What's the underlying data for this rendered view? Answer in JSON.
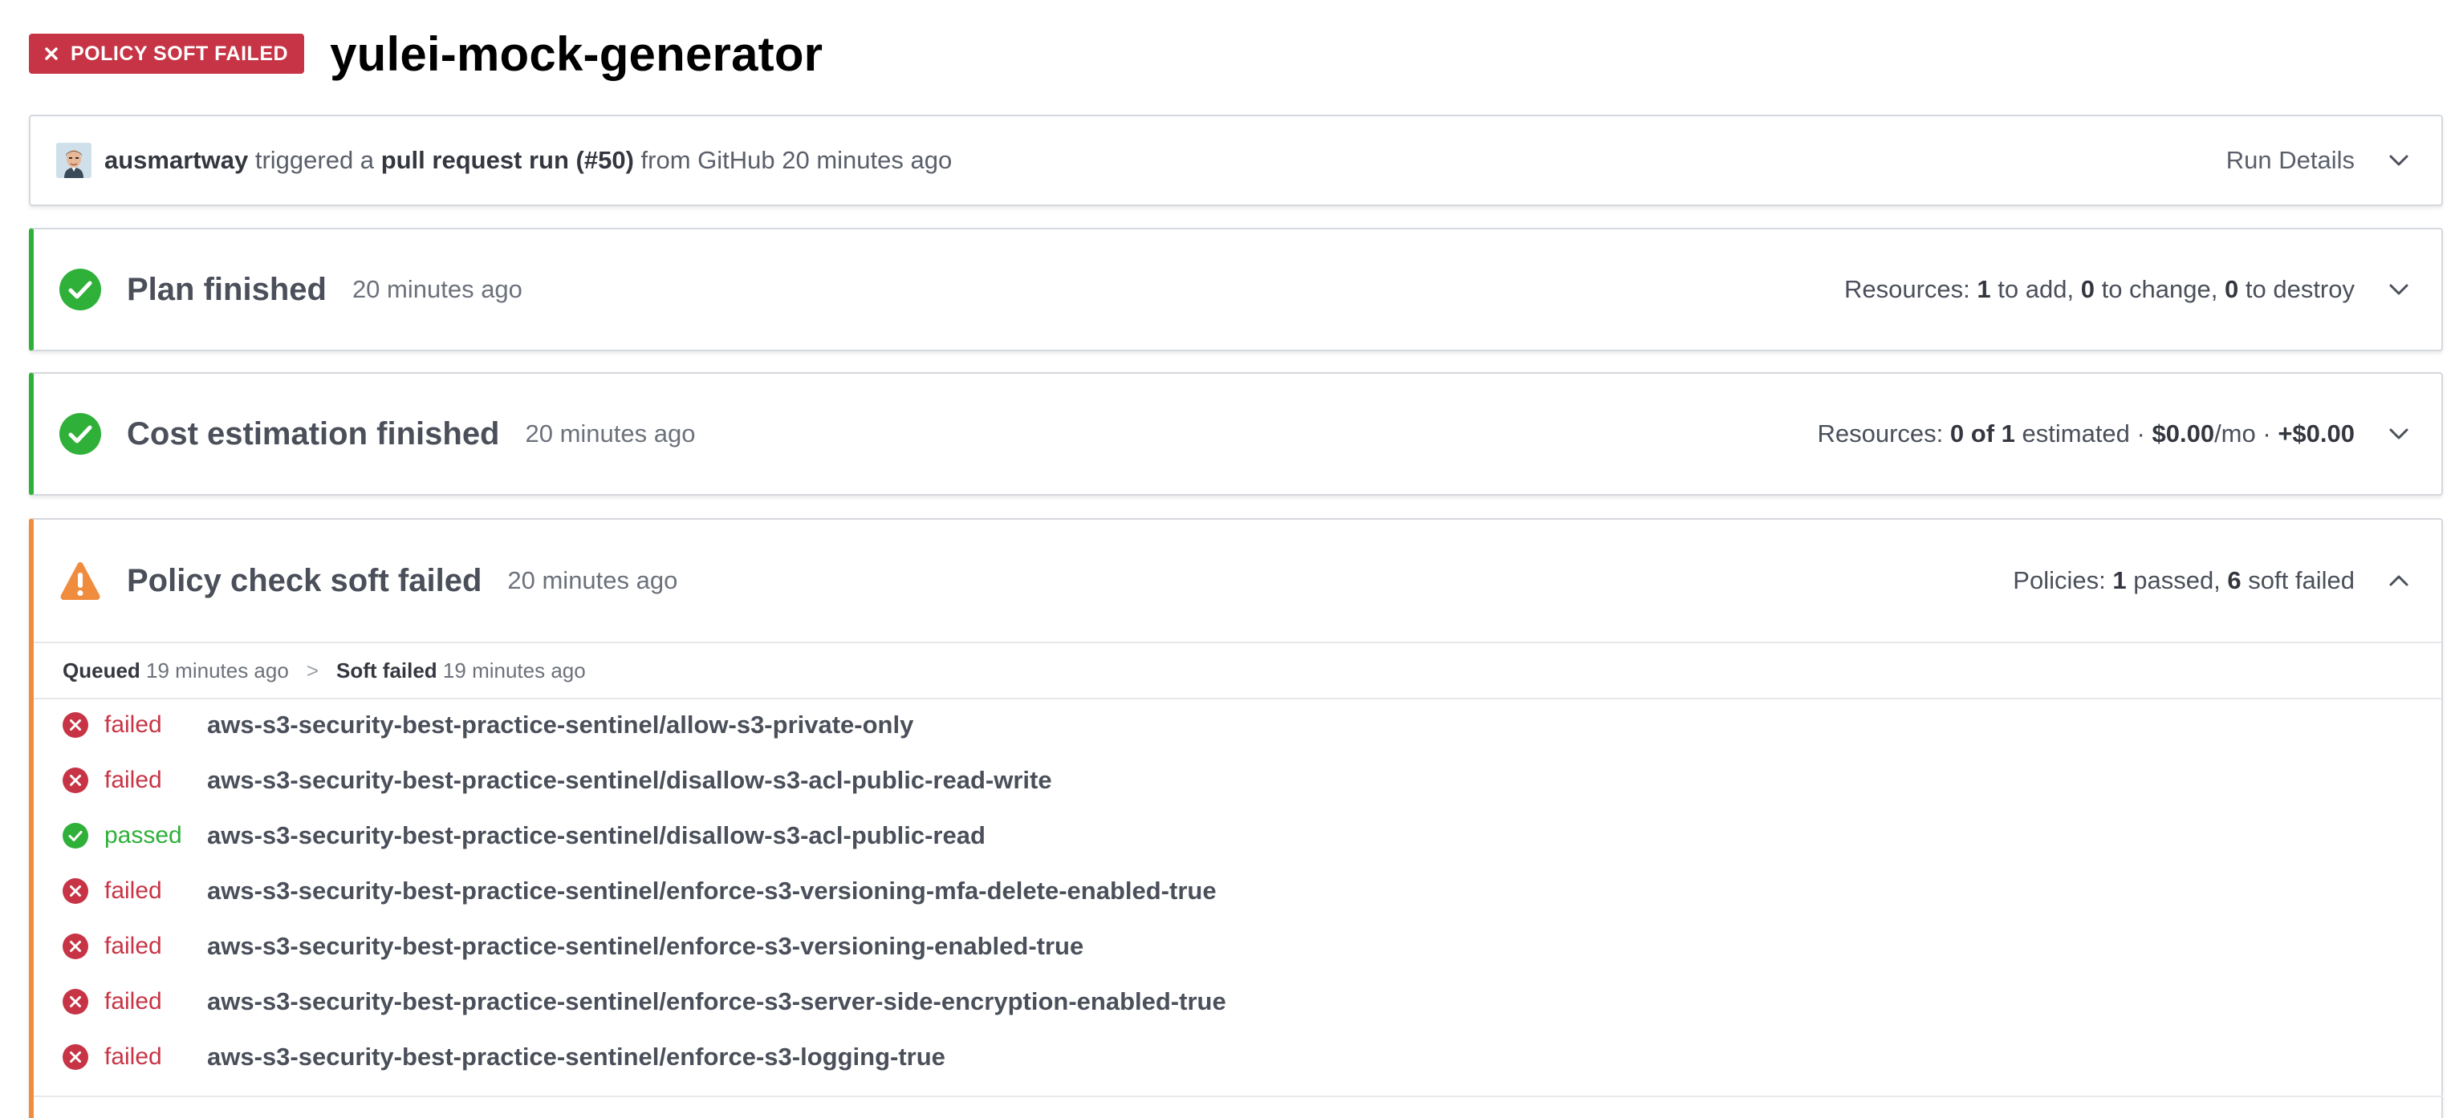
{
  "header": {
    "badge_label": "POLICY SOFT FAILED",
    "workspace_name": "yulei-mock-generator"
  },
  "run": {
    "user": "ausmartway",
    "text_triggered": "triggered a",
    "run_type": "pull request run (#50)",
    "text_from": "from GitHub 20 minutes ago",
    "details_label": "Run Details"
  },
  "plan": {
    "title": "Plan finished",
    "time": "20 minutes ago",
    "resources_label": "Resources:",
    "add": "1",
    "add_label": "to add,",
    "change": "0",
    "change_label": "to change,",
    "destroy": "0",
    "destroy_label": "to destroy"
  },
  "cost": {
    "title": "Cost estimation finished",
    "time": "20 minutes ago",
    "resources_label": "Resources:",
    "estimated": "0 of 1",
    "estimated_label": "estimated ·",
    "monthly": "$0.00",
    "monthly_suffix": "/mo ·",
    "delta": "+$0.00"
  },
  "policy": {
    "title": "Policy check soft failed",
    "time": "20 minutes ago",
    "policies_label": "Policies:",
    "passed": "1",
    "passed_label": "passed,",
    "soft_failed": "6",
    "soft_failed_label": "soft failed",
    "timeline": {
      "queued_label": "Queued",
      "queued_time": "19 minutes ago",
      "separator": ">",
      "soft_failed_label": "Soft failed",
      "soft_failed_time": "19 minutes ago"
    },
    "checks": [
      {
        "status": "failed",
        "name": "aws-s3-security-best-practice-sentinel/allow-s3-private-only"
      },
      {
        "status": "failed",
        "name": "aws-s3-security-best-practice-sentinel/disallow-s3-acl-public-read-write"
      },
      {
        "status": "passed",
        "name": "aws-s3-security-best-practice-sentinel/disallow-s3-acl-public-read"
      },
      {
        "status": "failed",
        "name": "aws-s3-security-best-practice-sentinel/enforce-s3-versioning-mfa-delete-enabled-true"
      },
      {
        "status": "failed",
        "name": "aws-s3-security-best-practice-sentinel/enforce-s3-versioning-enabled-true"
      },
      {
        "status": "failed",
        "name": "aws-s3-security-best-practice-sentinel/enforce-s3-server-side-encryption-enabled-true"
      },
      {
        "status": "failed",
        "name": "aws-s3-security-best-practice-sentinel/enforce-s3-logging-true"
      }
    ]
  },
  "colors": {
    "danger": "#c73445",
    "success": "#2eb039",
    "warning": "#f08c3d"
  }
}
